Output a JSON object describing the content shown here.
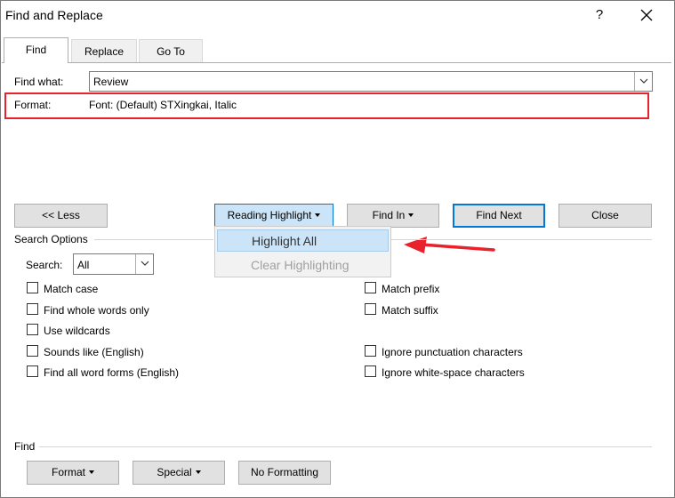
{
  "window": {
    "title": "Find and Replace",
    "help": "?",
    "close": "✕"
  },
  "tabs": [
    {
      "label": "Find"
    },
    {
      "label": "Replace"
    },
    {
      "label": "Go To"
    }
  ],
  "find_what": {
    "label": "Find what:",
    "value": "Review"
  },
  "format": {
    "label": "Format:",
    "value": "Font: (Default) STXingkai, Italic"
  },
  "buttons": {
    "less": "<< Less",
    "reading_highlight": "Reading Highlight",
    "find_in": "Find In",
    "find_next": "Find Next",
    "close": "Close"
  },
  "menu": {
    "items": [
      {
        "label": "Highlight All"
      },
      {
        "label": "Clear Highlighting"
      }
    ]
  },
  "search_options": {
    "title": "Search Options",
    "search_label": "Search:",
    "search_value": "All",
    "left": [
      {
        "label": "Match case"
      },
      {
        "label": "Find whole words only"
      },
      {
        "label": "Use wildcards"
      },
      {
        "label": "Sounds like (English)"
      },
      {
        "label": "Find all word forms (English)"
      }
    ],
    "right": [
      {
        "label": "Match prefix"
      },
      {
        "label": "Match suffix"
      },
      {
        "label": "Ignore punctuation characters"
      },
      {
        "label": "Ignore white-space characters"
      }
    ]
  },
  "find_section": {
    "title": "Find",
    "format": "Format",
    "special": "Special",
    "no_formatting": "No Formatting"
  },
  "colors": {
    "annotation": "#e8212b",
    "accent": "#0078d7"
  }
}
